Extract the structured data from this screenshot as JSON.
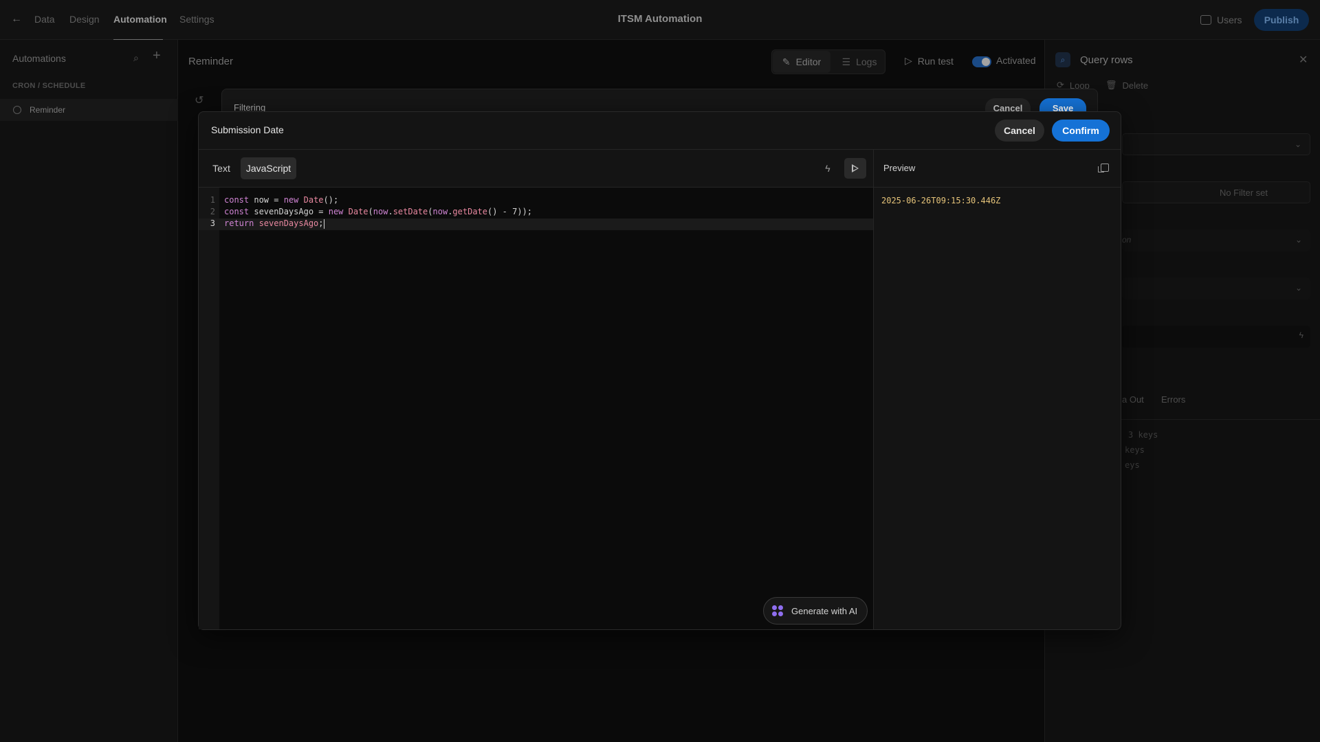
{
  "topbar": {
    "tabs": [
      {
        "label": "Data"
      },
      {
        "label": "Design"
      },
      {
        "label": "Automation"
      },
      {
        "label": "Settings"
      }
    ],
    "app_title": "ITSM Automation",
    "users_label": "Users",
    "publish_label": "Publish"
  },
  "sidebar": {
    "title": "Automations",
    "section": "CRON / SCHEDULE",
    "items": [
      {
        "label": "Reminder"
      }
    ]
  },
  "workspace": {
    "title": "Reminder",
    "editor_label": "Editor",
    "logs_label": "Logs",
    "run_test_label": "Run test",
    "activated_label": "Activated"
  },
  "right_panel": {
    "title": "Query rows",
    "loop_label": "Loop",
    "delete_label": "Delete",
    "no_filter": "No Filter set",
    "placeholder_frag": "on",
    "tab_data_out": "a Out",
    "tab_errors": "Errors",
    "json_rows": [
      "3 keys",
      "keys",
      "eys"
    ]
  },
  "filtering_modal": {
    "title": "Filtering",
    "cancel_label": "Cancel",
    "save_label": "Save"
  },
  "binding_modal": {
    "title": "Submission Date",
    "cancel_label": "Cancel",
    "confirm_label": "Confirm",
    "mode_text": "Text",
    "mode_js": "JavaScript",
    "preview_title": "Preview",
    "preview_value": "2025-06-26T09:15:30.446Z",
    "generate_ai_label": "Generate with AI",
    "line_numbers": [
      "1",
      "2",
      "3"
    ],
    "code": {
      "l1_kw": "const",
      "l1_a": " now = ",
      "l1_new": "new",
      "l1_cls": " Date",
      "l1_b": "();",
      "l2_kw": "const",
      "l2_a": " sevenDaysAgo = ",
      "l2_new": "new",
      "l2_cls": " Date",
      "l2_b": "(",
      "l2_now": "now",
      "l2_dot": ".",
      "l2_fn": "setDate",
      "l2_c": "(",
      "l2_now2": "now",
      "l2_dot2": ".",
      "l2_fn2": "getDate",
      "l2_d": "() - 7));",
      "l3_kw": "return",
      "l3_a": " sevenDaysAgo",
      "l3_b": ";"
    }
  },
  "colors": {
    "accent": "#1572d6",
    "preview_value": "#e6c47a",
    "keyword": "#d084d4"
  }
}
